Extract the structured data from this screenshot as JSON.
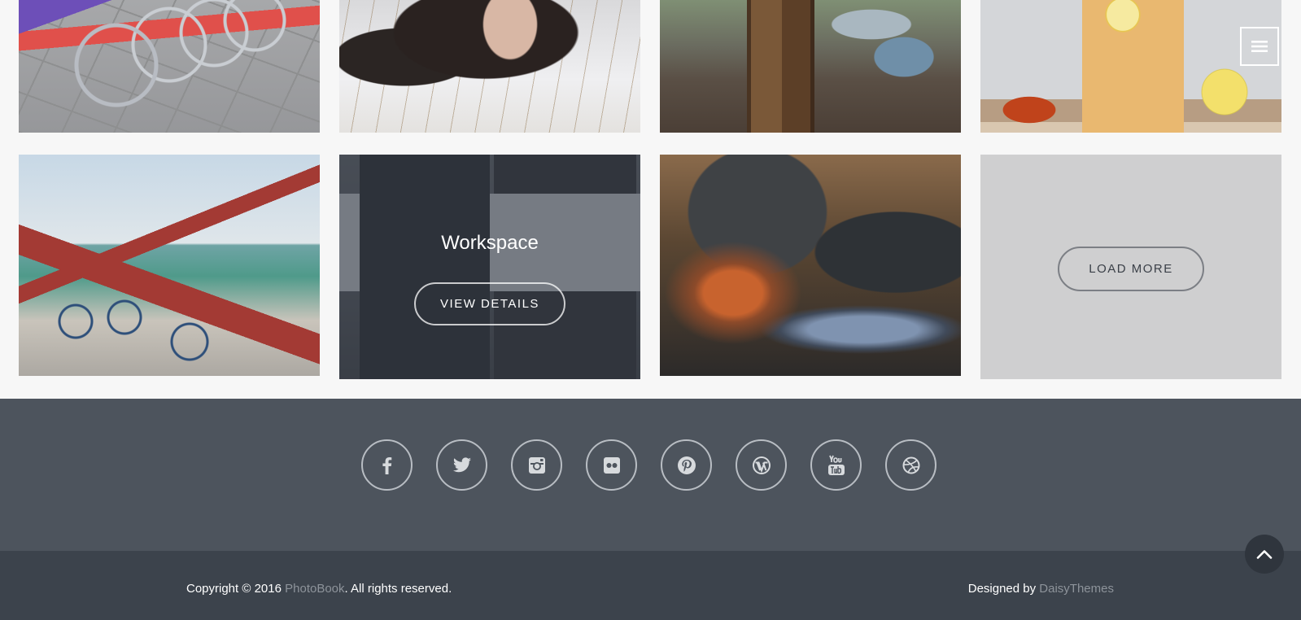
{
  "gallery": {
    "tiles": [
      {
        "name": "bikes-street",
        "kind": "photo"
      },
      {
        "name": "woman-snow",
        "kind": "photo"
      },
      {
        "name": "tree-stump",
        "kind": "photo"
      },
      {
        "name": "lemonade-jar",
        "kind": "photo"
      },
      {
        "name": "bikes-pier",
        "kind": "photo"
      },
      {
        "name": "workspace",
        "kind": "photo",
        "hover": true
      },
      {
        "name": "creek-rocks",
        "kind": "photo"
      }
    ],
    "hover_tile": {
      "title": "Workspace",
      "button_label": "VIEW DETAILS"
    },
    "load_more_label": "LOAD MORE"
  },
  "header": {
    "menu_icon": "hamburger-icon"
  },
  "footer": {
    "social_icons": [
      "facebook-icon",
      "twitter-icon",
      "instagram-icon",
      "flickr-icon",
      "pinterest-icon",
      "wordpress-icon",
      "youtube-icon",
      "dribbble-icon"
    ],
    "copyright_prefix": "Copyright © 2016 ",
    "brand": "PhotoBook",
    "copyright_suffix": ". All rights reserved.",
    "designed_by_prefix": "Designed by ",
    "designer": "DaisyThemes"
  },
  "back_to_top_icon": "chevron-up-icon",
  "colors": {
    "social_band": "#4d545d",
    "bottom_band": "#3c434c",
    "muted_link": "#8d939a",
    "load_tile": "#cfcfd0"
  }
}
